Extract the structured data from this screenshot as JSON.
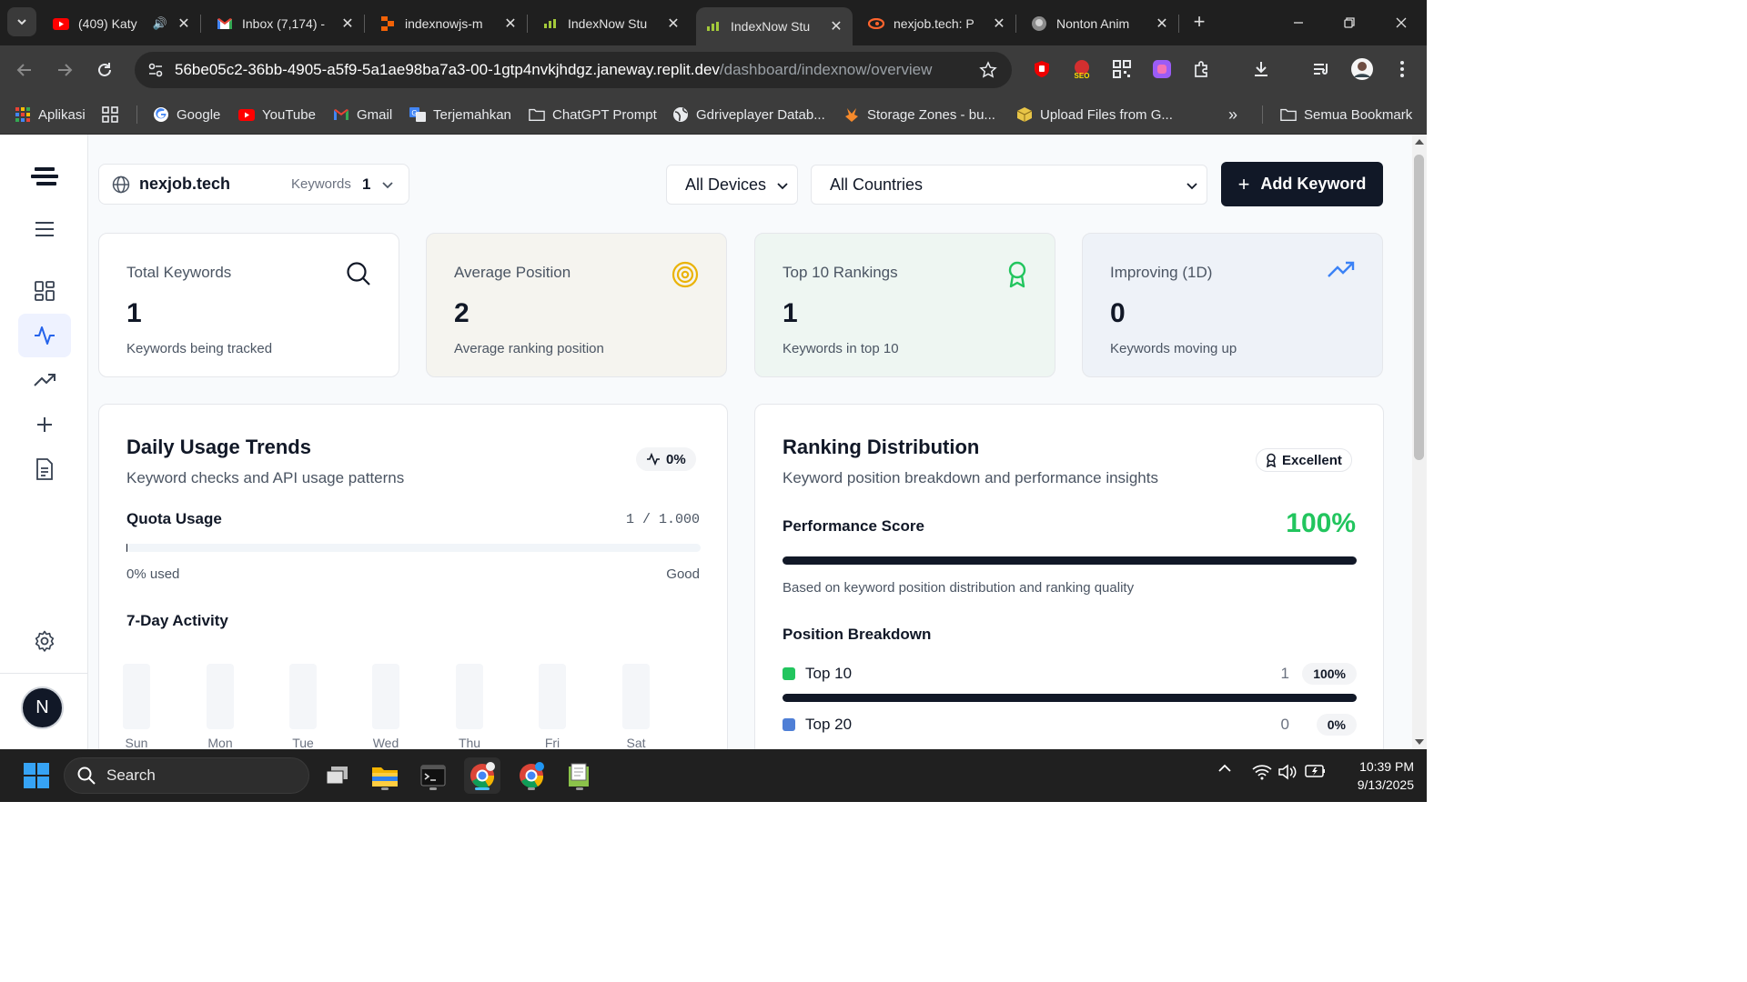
{
  "browser": {
    "tabs": [
      {
        "title": "(409) Katy",
        "favicon": "youtube-icon",
        "close": "✕"
      },
      {
        "title": "Inbox (7,174) -",
        "favicon": "gmail-icon",
        "close": "✕"
      },
      {
        "title": "indexnowjs-m",
        "favicon": "replit-icon",
        "close": "✕"
      },
      {
        "title": "IndexNow Stu",
        "favicon": "indexnow-icon",
        "close": "✕"
      },
      {
        "title": "IndexNow Stu",
        "favicon": "indexnow-icon",
        "close": "✕",
        "active": true
      },
      {
        "title": "nexjob.tech: P",
        "favicon": "semrush-icon",
        "close": "✕"
      },
      {
        "title": "Nonton Anim",
        "favicon": "site-icon",
        "close": "✕"
      }
    ],
    "new_tab": "+",
    "url_host": "56be05c2-36bb-4905-a5f9-5a1ae98ba7a3-00-1gtp4nvkjhdgz.janeway.replit.dev",
    "url_path": "/dashboard/indexnow/overview",
    "bookmarks": [
      {
        "label": "Aplikasi",
        "icon": "apps-grid-icon"
      },
      {
        "label": "Google",
        "icon": "google-icon"
      },
      {
        "label": "YouTube",
        "icon": "youtube-icon"
      },
      {
        "label": "Gmail",
        "icon": "gmail-icon"
      },
      {
        "label": "Terjemahkan",
        "icon": "translate-icon"
      },
      {
        "label": "ChatGPT Prompt",
        "icon": "folder-icon"
      },
      {
        "label": "Gdriveplayer Datab...",
        "icon": "globe-icon"
      },
      {
        "label": "Storage Zones - bu...",
        "icon": "bunny-icon"
      },
      {
        "label": "Upload Files from G...",
        "icon": "box-icon"
      }
    ],
    "bookmarks_more": "»",
    "all_bookmarks": "Semua Bookmark"
  },
  "filters": {
    "domain": "nexjob.tech",
    "keywords_label": "Keywords",
    "keywords_count": "1",
    "device": "All Devices",
    "country": "All Countries",
    "add_keyword": "Add Keyword"
  },
  "stats": [
    {
      "label": "Total Keywords",
      "value": "1",
      "sub": "Keywords being tracked",
      "icon": "search-icon",
      "bg": "#ffffff",
      "color": "#111827"
    },
    {
      "label": "Average Position",
      "value": "2",
      "sub": "Average ranking position",
      "icon": "target-icon",
      "bg": "#f5f4ef",
      "color": "#eab308"
    },
    {
      "label": "Top 10 Rankings",
      "value": "1",
      "sub": "Keywords in top 10",
      "icon": "award-icon",
      "bg": "#eef6f2",
      "color": "#22c55e"
    },
    {
      "label": "Improving (1D)",
      "value": "0",
      "sub": "Keywords moving up",
      "icon": "trending-up-icon",
      "bg": "#eef2f8",
      "color": "#3b82f6"
    }
  ],
  "usage": {
    "title": "Daily Usage Trends",
    "subtitle": "Keyword checks and API usage patterns",
    "change": "0%",
    "quota_label": "Quota Usage",
    "quota_value": "1 / 1.000",
    "quota_fraction": 0.001,
    "used_label": "0% used",
    "status": "Good",
    "activity_title": "7-Day Activity",
    "days": [
      "Sun",
      "Mon",
      "Tue",
      "Wed",
      "Thu",
      "Fri",
      "Sat"
    ]
  },
  "ranking": {
    "title": "Ranking Distribution",
    "subtitle": "Keyword position breakdown and performance insights",
    "badge": "Excellent",
    "score_label": "Performance Score",
    "score_value": "100%",
    "score_fraction": 1.0,
    "note": "Based on keyword position distribution and ranking quality",
    "breakdown_title": "Position Breakdown",
    "rows": [
      {
        "name": "Top 10",
        "count": "1",
        "pct": "100%",
        "fraction": 1.0,
        "color": "#22c55e"
      },
      {
        "name": "Top 20",
        "count": "0",
        "pct": "0%",
        "fraction": 0.0,
        "color": "#4f7fd6"
      }
    ]
  },
  "sidebar": {
    "avatar": "N"
  },
  "taskbar": {
    "search": "Search",
    "time": "10:39 PM",
    "date": "9/13/2025"
  }
}
